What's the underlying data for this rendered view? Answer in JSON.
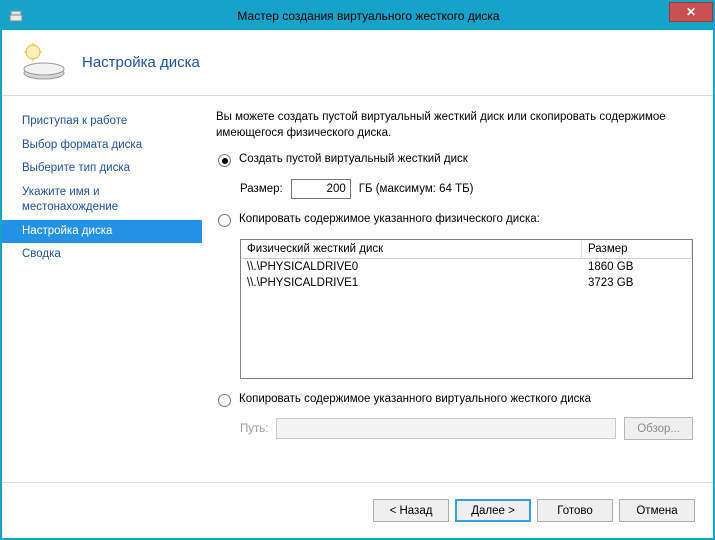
{
  "window": {
    "title": "Мастер создания виртуального жесткого диска"
  },
  "header": {
    "title": "Настройка диска"
  },
  "sidebar": {
    "items": [
      {
        "label": "Приступая к работе"
      },
      {
        "label": "Выбор формата диска"
      },
      {
        "label": "Выберите тип диска"
      },
      {
        "label": "Укажите имя и местонахождение"
      },
      {
        "label": "Настройка диска"
      },
      {
        "label": "Сводка"
      }
    ],
    "selected_index": 4
  },
  "main": {
    "intro": "Вы можете создать пустой виртуальный жесткий диск или скопировать содержимое имеющегося физического диска.",
    "opt_create_blank": "Создать пустой виртуальный жесткий диск",
    "size_label": "Размер:",
    "size_value": "200",
    "size_suffix": "ГБ (максимум: 64 ТБ)",
    "opt_copy_physical": "Копировать содержимое указанного физического диска:",
    "disk_table": {
      "col_disk": "Физический жесткий диск",
      "col_size": "Размер",
      "rows": [
        {
          "name": "\\\\.\\PHYSICALDRIVE0",
          "size": "1860 GB"
        },
        {
          "name": "\\\\.\\PHYSICALDRIVE1",
          "size": "3723 GB"
        }
      ]
    },
    "opt_copy_virtual": "Копировать содержимое указанного виртуального жесткого диска",
    "path_label": "Путь:",
    "path_value": "",
    "browse_label": "Обзор..."
  },
  "footer": {
    "back": "< Назад",
    "next": "Далее >",
    "finish": "Готово",
    "cancel": "Отмена"
  },
  "selected_option": "create_blank"
}
